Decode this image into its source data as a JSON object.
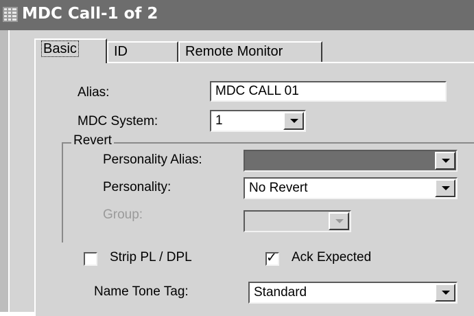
{
  "window": {
    "title": "MDC Call-1 of 2",
    "icon": "grid-window-icon"
  },
  "tabs": [
    {
      "label": "Basic",
      "active": true
    },
    {
      "label": "ID",
      "active": false
    },
    {
      "label": "Remote Monitor",
      "active": false
    }
  ],
  "basic": {
    "alias_label": "Alias:",
    "alias_value": "MDC CALL 01",
    "mdc_system_label": "MDC System:",
    "mdc_system_value": "1",
    "revert": {
      "group_label": "Revert",
      "personality_alias_label": "Personality Alias:",
      "personality_alias_value": "",
      "personality_label": "Personality:",
      "personality_value": "No Revert",
      "group_field_label": "Group:",
      "group_field_value": ""
    },
    "strip_pl_label": "Strip PL / DPL",
    "strip_pl_checked": false,
    "ack_expected_label": "Ack Expected",
    "ack_expected_checked": true,
    "name_tone_tag_label": "Name Tone Tag:",
    "name_tone_tag_value": "Standard"
  },
  "colors": {
    "titlebar": "#6d6d6d",
    "panel": "#d4d4d4",
    "disabled_text": "#9a9a9a"
  }
}
